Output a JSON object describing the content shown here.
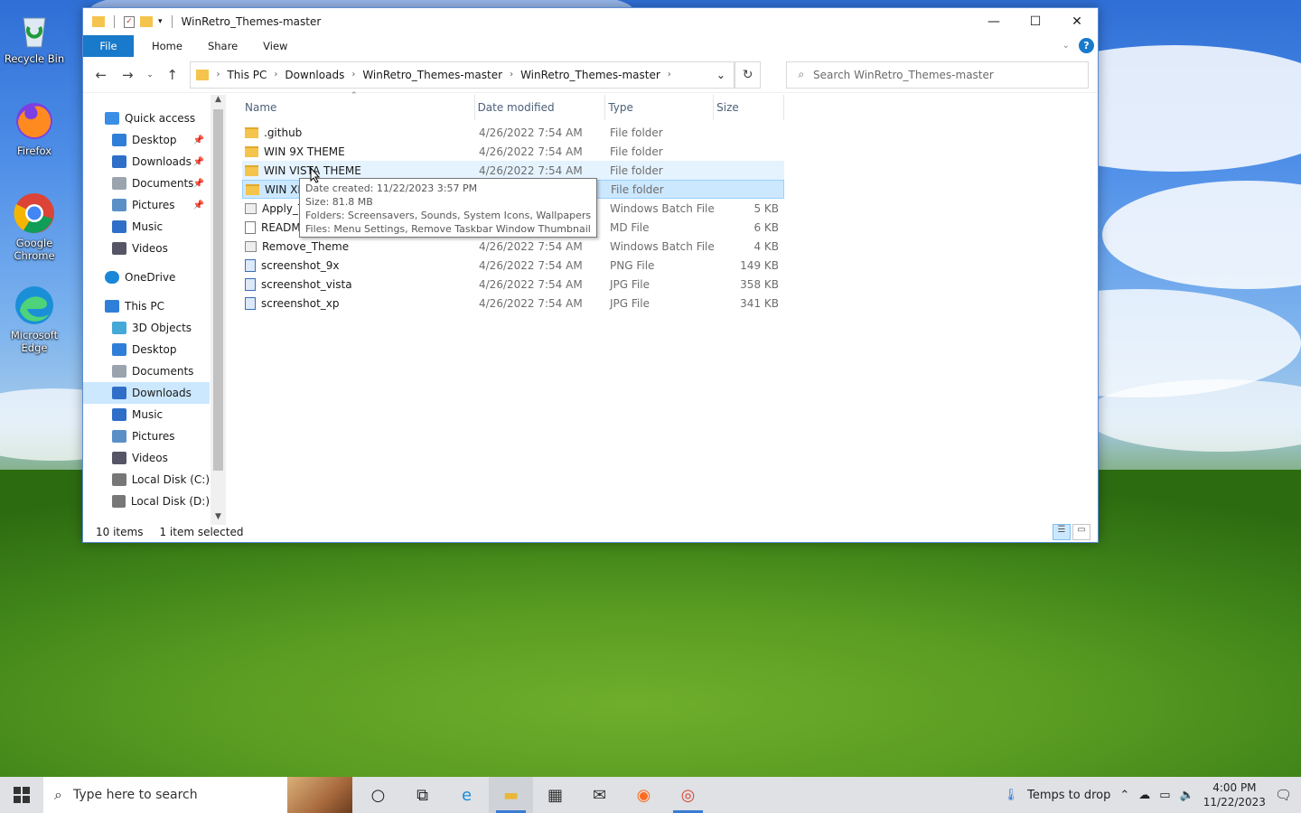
{
  "desktop": {
    "icons": [
      {
        "label": "Recycle Bin",
        "icon": "recycle-bin-icon"
      },
      {
        "label": "Firefox",
        "icon": "firefox-icon"
      },
      {
        "label": "Google Chrome",
        "icon": "chrome-icon"
      },
      {
        "label": "Microsoft Edge",
        "icon": "edge-icon"
      }
    ]
  },
  "window": {
    "title": "WinRetro_Themes-master",
    "controls": {
      "minimize": "—",
      "maximize": "☐",
      "close": "✕"
    },
    "ribbon": {
      "file": "File",
      "home": "Home",
      "share": "Share",
      "view": "View",
      "help": "?"
    },
    "address": {
      "crumbs": [
        "This PC",
        "Downloads",
        "WinRetro_Themes-master",
        "WinRetro_Themes-master"
      ]
    },
    "search_placeholder": "Search WinRetro_Themes-master",
    "nav": {
      "items": [
        {
          "label": "Quick access",
          "icon": "star-icon",
          "indent": 0,
          "pinned": false
        },
        {
          "label": "Desktop",
          "icon": "desktop-icon",
          "indent": 1,
          "pinned": true
        },
        {
          "label": "Downloads",
          "icon": "download-icon",
          "indent": 1,
          "pinned": true
        },
        {
          "label": "Documents",
          "icon": "documents-icon",
          "indent": 1,
          "pinned": true
        },
        {
          "label": "Pictures",
          "icon": "pictures-icon",
          "indent": 1,
          "pinned": true
        },
        {
          "label": "Music",
          "icon": "music-icon",
          "indent": 1,
          "pinned": false
        },
        {
          "label": "Videos",
          "icon": "videos-icon",
          "indent": 1,
          "pinned": false
        },
        {
          "label": "OneDrive",
          "icon": "cloud-icon",
          "indent": 0,
          "pinned": false
        },
        {
          "label": "This PC",
          "icon": "computer-icon",
          "indent": 0,
          "pinned": false
        },
        {
          "label": "3D Objects",
          "icon": "cube-icon",
          "indent": 1,
          "pinned": false
        },
        {
          "label": "Desktop",
          "icon": "desktop-icon",
          "indent": 1,
          "pinned": false
        },
        {
          "label": "Documents",
          "icon": "documents-icon",
          "indent": 1,
          "pinned": false
        },
        {
          "label": "Downloads",
          "icon": "download-icon",
          "indent": 1,
          "pinned": false,
          "selected": true
        },
        {
          "label": "Music",
          "icon": "music-icon",
          "indent": 1,
          "pinned": false
        },
        {
          "label": "Pictures",
          "icon": "pictures-icon",
          "indent": 1,
          "pinned": false
        },
        {
          "label": "Videos",
          "icon": "videos-icon",
          "indent": 1,
          "pinned": false
        },
        {
          "label": "Local Disk (C:)",
          "icon": "drive-icon",
          "indent": 1,
          "pinned": false
        },
        {
          "label": "Local Disk (D:)",
          "icon": "drive-icon",
          "indent": 1,
          "pinned": false
        }
      ]
    },
    "columns": {
      "name": "Name",
      "date": "Date modified",
      "type": "Type",
      "size": "Size"
    },
    "files": [
      {
        "name": ".github",
        "date": "4/26/2022 7:54 AM",
        "type": "File folder",
        "size": "",
        "kind": "folder"
      },
      {
        "name": "WIN 9X THEME",
        "date": "4/26/2022 7:54 AM",
        "type": "File folder",
        "size": "",
        "kind": "folder"
      },
      {
        "name": "WIN VISTA THEME",
        "date": "4/26/2022 7:54 AM",
        "type": "File folder",
        "size": "",
        "kind": "folder",
        "state": "hover"
      },
      {
        "name": "WIN XP",
        "date": "",
        "type": "File folder",
        "size": "",
        "kind": "folder",
        "state": "selected"
      },
      {
        "name": "Apply_T",
        "date": "",
        "type": "Windows Batch File",
        "size": "5 KB",
        "kind": "batch"
      },
      {
        "name": "READM",
        "date": "",
        "type": "MD File",
        "size": "6 KB",
        "kind": "file"
      },
      {
        "name": "Remove_Theme",
        "date": "4/26/2022 7:54 AM",
        "type": "Windows Batch File",
        "size": "4 KB",
        "kind": "batch"
      },
      {
        "name": "screenshot_9x",
        "date": "4/26/2022 7:54 AM",
        "type": "PNG File",
        "size": "149 KB",
        "kind": "image"
      },
      {
        "name": "screenshot_vista",
        "date": "4/26/2022 7:54 AM",
        "type": "JPG File",
        "size": "358 KB",
        "kind": "image"
      },
      {
        "name": "screenshot_xp",
        "date": "4/26/2022 7:54 AM",
        "type": "JPG File",
        "size": "341 KB",
        "kind": "image"
      }
    ],
    "tooltip": {
      "created": "Date created: 11/22/2023 3:57 PM",
      "size": "Size: 81.8 MB",
      "folders": "Folders: Screensavers, Sounds, System Icons, Wallpapers",
      "files": "Files: Menu Settings, Remove Taskbar Window Thumbnail, ..."
    },
    "status": {
      "count": "10 items",
      "selection": "1 item selected"
    }
  },
  "taskbar": {
    "search_placeholder": "Type here to search",
    "apps": [
      {
        "icon": "cortana-icon",
        "glyph": "○"
      },
      {
        "icon": "task-view-icon",
        "glyph": "⧉"
      },
      {
        "icon": "edge-icon",
        "glyph": "e"
      },
      {
        "icon": "file-explorer-icon",
        "glyph": "▬",
        "state": "active"
      },
      {
        "icon": "store-icon",
        "glyph": "▦"
      },
      {
        "icon": "mail-icon",
        "glyph": "✉"
      },
      {
        "icon": "firefox-icon",
        "glyph": "◉"
      },
      {
        "icon": "chrome-icon",
        "glyph": "◎",
        "state": "open"
      }
    ],
    "weather": "Temps to drop",
    "time": "4:00 PM",
    "date": "11/22/2023"
  },
  "colors": {
    "accent": "#1979ca",
    "selection": "#cce8ff",
    "taskbar": "#dfe1e4"
  }
}
